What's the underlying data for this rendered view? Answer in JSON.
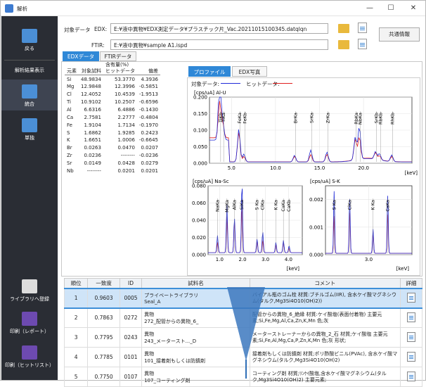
{
  "window": {
    "title": "解析",
    "min": "—",
    "max": "☐",
    "close": "✕"
  },
  "sidebar": {
    "back": "戻る",
    "analysis_display": "解析結果表示",
    "integrate": "統合",
    "single": "単独",
    "library_register": "ライブラリへ登録",
    "print_report": "印刷（レポート）",
    "print_hitlist": "印刷（ヒットリスト）"
  },
  "header": {
    "target_data": "対象データ",
    "edx_label": "EDX:",
    "edx_path": "E:¥液中異物¥EDX測定データ¥プラスチック片_Vac.20211015100345.datqlqn",
    "ftir_label": "FTIR:",
    "ftir_path": "E:¥液中異物¥sample A1.ispd",
    "share_btn": "共通情報"
  },
  "tabs": {
    "edx": "EDXデータ",
    "ftir": "FTIRデータ"
  },
  "composition": {
    "group": "含有量(%)",
    "headers": [
      "元素",
      "対象試料",
      "ヒットデータ",
      "偏差"
    ],
    "rows": [
      [
        "Si",
        "48.9834",
        "53.3770",
        "4.3936"
      ],
      [
        "Mg",
        "12.9848",
        "12.3996",
        "-0.5851"
      ],
      [
        "Cl",
        "12.4052",
        "10.4539",
        "-1.9513"
      ],
      [
        "Ti",
        "10.9102",
        "10.2507",
        "-0.6596"
      ],
      [
        "Al",
        "6.6316",
        "6.4886",
        "-0.1430"
      ],
      [
        "Ca",
        "2.7581",
        "2.2777",
        "-0.4804"
      ],
      [
        "Fe",
        "1.9104",
        "1.7134",
        "-0.1970"
      ],
      [
        "S",
        "1.6862",
        "1.9285",
        "0.2423"
      ],
      [
        "K",
        "1.6651",
        "1.0006",
        "-0.6645"
      ],
      [
        "Br",
        "0.0263",
        "0.0470",
        "0.0207"
      ],
      [
        "Zr",
        "0.0236",
        "--------",
        "-0.0236"
      ],
      [
        "Sr",
        "0.0149",
        "0.0428",
        "0.0279"
      ],
      [
        "Nb",
        "--------",
        "0.0201",
        "0.0201"
      ]
    ]
  },
  "chart_tabs": {
    "profile": "プロファイル",
    "photo": "EDX写真"
  },
  "legend": {
    "target": "対象データ:",
    "hit": "ヒットデータ:"
  },
  "colors": {
    "target": "#1f2ad8",
    "hit": "#e02020",
    "accent": "#2f88d7"
  },
  "chart_data": [
    {
      "type": "line",
      "title": "[cps/uA] Al-U",
      "xlabel": "[keV]",
      "xlim": [
        2.5,
        25.5
      ],
      "ylim": [
        0,
        0.2
      ],
      "yticks": [
        "0.000",
        "0.050",
        "0.100",
        "0.150",
        "0.200"
      ],
      "xticks": [
        "5.0",
        "10.0",
        "15.0",
        "20.0"
      ],
      "peaks": [
        "TiKb",
        "TiKa",
        "FeKa",
        "FeKb",
        "BrKa",
        "SrKa",
        "ZrKa",
        "RbKa",
        "NbKa",
        "SrKb",
        "RbKb",
        "RhKb"
      ]
    },
    {
      "type": "line",
      "title": "[cps/uA] Na-Sc",
      "xlabel": "[keV]",
      "xlim": [
        0.5,
        4.6
      ],
      "ylim": [
        0,
        0.08
      ],
      "yticks": [
        "0.000",
        "0.020",
        "0.040",
        "0.060",
        "0.080"
      ],
      "xticks": [
        "1.0",
        "2.0",
        "3.0",
        "4.0"
      ],
      "peaks": [
        "NaKa",
        "MgKa",
        "AlKa",
        "SiKa",
        "S Ka",
        "ClKa",
        "K Ka",
        "CaKa",
        "CaKb"
      ]
    },
    {
      "type": "line",
      "title": "[cps/uA] S-K",
      "xlabel": "[keV]",
      "xlim": [
        2.0,
        4.0
      ],
      "ylim": [
        0,
        0.0025
      ],
      "yticks": [
        "0.000",
        "0.001",
        "0.002"
      ],
      "xticks": [
        "3.0"
      ],
      "peaks": [
        "S Ka",
        "ClKa",
        "K Ka",
        "CaKa"
      ]
    }
  ],
  "results": {
    "headers": [
      "順位",
      "一致度",
      "ID",
      "試料名",
      "コメント",
      "詳細"
    ],
    "rows": [
      {
        "rank": "1",
        "match": "0.9603",
        "id": "0005",
        "name": "プライベートライブラリ\nSeal_A",
        "comment": "バイアル瓶のゴム栓 材質:ブチルゴム(IIR), 含水ケイ酸マグネシウム(タルク,Mg3Si4O10(OH)2))"
      },
      {
        "rank": "2",
        "match": "0.7863",
        "id": "0272",
        "name": "異物\n272_配管からの異物_6_",
        "comment": "配管からの異物_6_絶縁 材質:ケイ酸塩(表面付着物) 主要元素;Si,Fe,Mg,Al,Ca,Zn,K,Mn 色;灰"
      },
      {
        "rank": "3",
        "match": "0.7795",
        "id": "0243",
        "name": "異物\n243_メータースト..._D",
        "comment": "メーターストレーナーからの異物_2_石 材質;ケイ酸塩 主要元素;Si,Fe,Al,Mg,Ca,P,Zn,K,Mn 色;灰 形状;"
      },
      {
        "rank": "4",
        "match": "0.7785",
        "id": "0101",
        "name": "異物\n101_接着剤もしくは防錆剤",
        "comment": "接着剤もしくは防錆剤 材質;ポリ酢酸ビニル(PVAc), 含水ケイ酸マグネシウム(タルク,Mg3Si4O10(OH)2)"
      },
      {
        "rank": "5",
        "match": "0.7750",
        "id": "0107",
        "name": "異物\n107_コーティング剤",
        "comment": "コーティング剤 材質;ﾘﾝｹｲ酸塩,含水ケイ酸マグネシウム(タルク,Mg3Si4O10(OH)2) 主要元素;"
      }
    ]
  }
}
